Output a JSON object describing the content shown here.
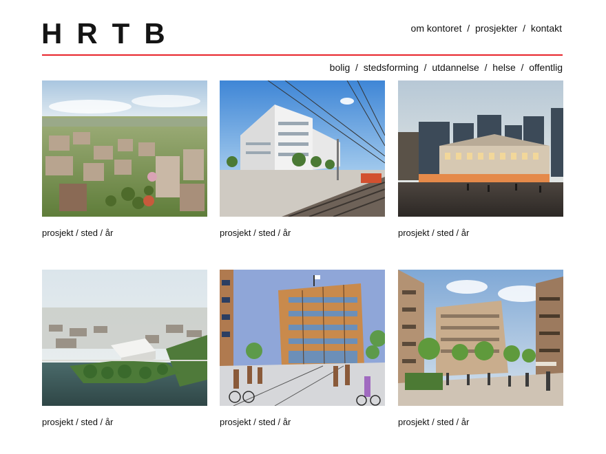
{
  "header": {
    "logo": "HRTB",
    "top_nav": [
      {
        "label": "om kontoret"
      },
      {
        "label": "prosjekter"
      },
      {
        "label": "kontakt"
      }
    ],
    "separator": "/",
    "accent_color": "#e8232a"
  },
  "categories": [
    {
      "label": "bolig"
    },
    {
      "label": "stedsforming"
    },
    {
      "label": "utdannelse"
    },
    {
      "label": "helse"
    },
    {
      "label": "offentlig"
    }
  ],
  "projects": [
    {
      "image": "aerial-residential-neighborhood",
      "caption": "prosjekt / sted / år"
    },
    {
      "image": "white-building-by-railway",
      "caption": "prosjekt / sted / år"
    },
    {
      "image": "lit-historic-building-evening-plaza",
      "caption": "prosjekt / sted / år"
    },
    {
      "image": "aerial-city-by-river",
      "caption": "prosjekt / sted / år"
    },
    {
      "image": "sketch-street-with-cyclists",
      "caption": "prosjekt / sted / år"
    },
    {
      "image": "pedestrian-square-with-trees",
      "caption": "prosjekt / sted / år"
    }
  ]
}
